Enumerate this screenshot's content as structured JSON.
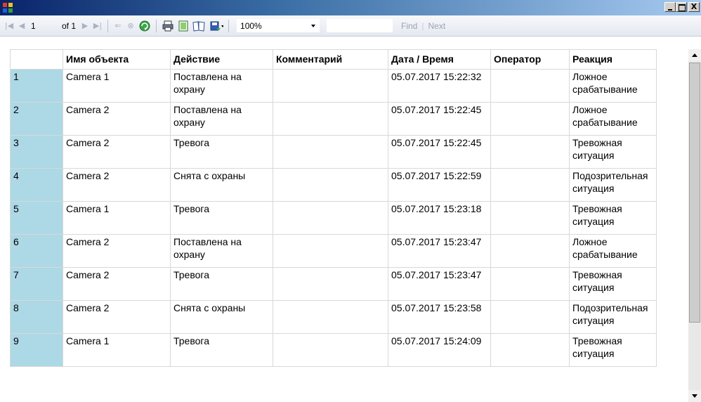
{
  "window": {
    "icon": "report-app-icon",
    "controls": {
      "minimize": "_",
      "maximize": "□",
      "close": "X"
    }
  },
  "toolbar": {
    "page_current": "1",
    "page_of": "of 1",
    "zoom": "100%",
    "find_placeholder": "",
    "find_label": "Find",
    "separator": "|",
    "next_label": "Next"
  },
  "grid": {
    "columns": [
      "Имя объекта",
      "Действие",
      "Комментарий",
      "Дата / Время",
      "Оператор",
      "Реакция"
    ],
    "rows": [
      {
        "num": "1",
        "object": "Camera 1",
        "action": "Поставлена на охрану",
        "comment": "",
        "datetime": "05.07.2017 15:22:32",
        "operator": "",
        "reaction": "Ложное срабатывание"
      },
      {
        "num": "2",
        "object": "Camera 2",
        "action": "Поставлена на охрану",
        "comment": "",
        "datetime": "05.07.2017 15:22:45",
        "operator": "",
        "reaction": "Ложное срабатывание"
      },
      {
        "num": "3",
        "object": "Camera 2",
        "action": "Тревога",
        "comment": "",
        "datetime": "05.07.2017 15:22:45",
        "operator": "",
        "reaction": "Тревожная ситуация"
      },
      {
        "num": "4",
        "object": "Camera 2",
        "action": "Снята с охраны",
        "comment": "",
        "datetime": "05.07.2017 15:22:59",
        "operator": "",
        "reaction": "Подозрительная ситуация"
      },
      {
        "num": "5",
        "object": "Camera 1",
        "action": "Тревога",
        "comment": "",
        "datetime": "05.07.2017 15:23:18",
        "operator": "",
        "reaction": "Тревожная ситуация"
      },
      {
        "num": "6",
        "object": "Camera 2",
        "action": "Поставлена на охрану",
        "comment": "",
        "datetime": "05.07.2017 15:23:47",
        "operator": "",
        "reaction": "Ложное срабатывание"
      },
      {
        "num": "7",
        "object": "Camera 2",
        "action": "Тревога",
        "comment": "",
        "datetime": "05.07.2017 15:23:47",
        "operator": "",
        "reaction": "Тревожная ситуация"
      },
      {
        "num": "8",
        "object": "Camera 2",
        "action": "Снята с охраны",
        "comment": "",
        "datetime": "05.07.2017 15:23:58",
        "operator": "",
        "reaction": "Подозрительная ситуация"
      },
      {
        "num": "9",
        "object": "Camera 1",
        "action": "Тревога",
        "comment": "",
        "datetime": "05.07.2017 15:24:09",
        "operator": "",
        "reaction": "Тревожная ситуация"
      }
    ]
  },
  "colors": {
    "row_number_bg": "#add8e6",
    "titlebar_start": "#0a246a",
    "titlebar_end": "#a6caf0"
  }
}
